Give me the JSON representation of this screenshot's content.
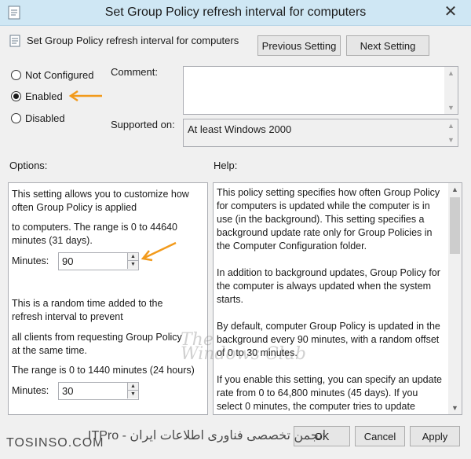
{
  "window": {
    "title": "Set Group Policy refresh interval for computers",
    "close_glyph": "✕"
  },
  "header": {
    "setting_name": "Set Group Policy refresh interval for computers",
    "previous_label": "Previous Setting",
    "next_label": "Next Setting"
  },
  "state": {
    "options": [
      {
        "label": "Not Configured",
        "checked": false
      },
      {
        "label": "Enabled",
        "checked": true
      },
      {
        "label": "Disabled",
        "checked": false
      }
    ]
  },
  "comment": {
    "label": "Comment:",
    "value": ""
  },
  "supported": {
    "label": "Supported on:",
    "value": "At least Windows 2000"
  },
  "options_label": "Options:",
  "help_label": "Help:",
  "options_panel": {
    "line1": "This setting allows you to customize how",
    "line2": "often Group Policy is applied",
    "line3": "to computers. The range is 0 to 44640",
    "line4": "minutes (31 days).",
    "minutes1_label": "Minutes:",
    "minutes1_value": "90",
    "line5": "This is a random time added to the",
    "line6": "refresh interval to prevent",
    "line7": "all clients from requesting Group Policy",
    "line8": "at the same time.",
    "line9": "The range is 0 to 1440 minutes (24 hours)",
    "minutes2_label": "Minutes:",
    "minutes2_value": "30"
  },
  "help_panel": {
    "para1": "This policy setting specifies how often Group Policy for computers is updated while the computer is in use (in the background). This setting specifies a background update rate only for Group Policies in the Computer Configuration folder.",
    "para2": "In addition to background updates, Group Policy for the computer is always updated when the system starts.",
    "para3": "By default, computer Group Policy is updated in the background every 90 minutes, with a random offset of 0 to 30 minutes.",
    "para4": "If you enable this setting, you can specify an update rate from 0 to 64,800 minutes (45 days). If you select 0 minutes, the computer tries to update"
  },
  "footer": {
    "ok_label": "OK",
    "cancel_label": "Cancel",
    "apply_label": "Apply"
  },
  "overlay": {
    "watermark_line1": "The",
    "watermark_line2": "Windows Club",
    "site": "TOSINSO.COM",
    "arabic": "انجمن تخصصی فناوری اطلاعات ایران - ITPro"
  },
  "colors": {
    "titlebar": "#cfe7f4",
    "annotation_arrow": "#f29a1b"
  }
}
